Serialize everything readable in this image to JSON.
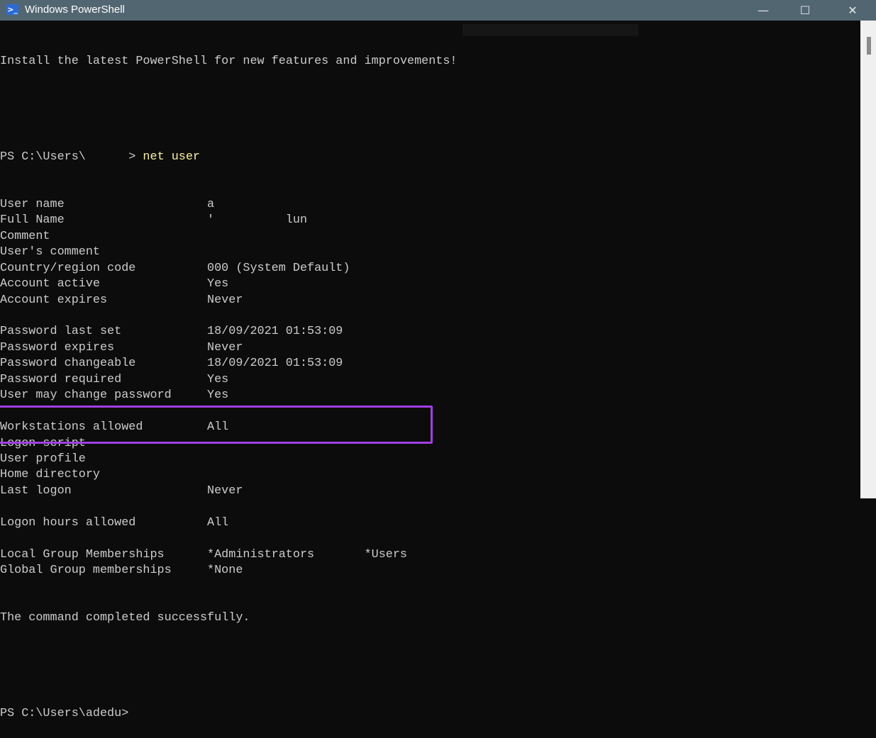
{
  "window": {
    "title": "Windows PowerShell",
    "app_icon": "powershell-icon",
    "controls": {
      "minimize": "—",
      "maximize": "☐",
      "close": "✕"
    }
  },
  "colors": {
    "highlight": "#a23ee6",
    "command": "#f9f1a5",
    "titlebar": "#526672"
  },
  "terminal": {
    "banner": "Install the latest PowerShell for new features and improvements!",
    "prompt1": "PS C:\\Users\\      > ",
    "command": "net user",
    "rows": [
      {
        "label": "User name",
        "value": "a"
      },
      {
        "label": "Full Name",
        "value": "'          lun"
      },
      {
        "label": "Comment",
        "value": ""
      },
      {
        "label": "User's comment",
        "value": ""
      },
      {
        "label": "Country/region code",
        "value": "000 (System Default)"
      },
      {
        "label": "Account active",
        "value": "Yes"
      },
      {
        "label": "Account expires",
        "value": "Never"
      },
      {
        "label": "",
        "value": ""
      },
      {
        "label": "Password last set",
        "value": "18/09/2021 01:53:09"
      },
      {
        "label": "Password expires",
        "value": "Never"
      },
      {
        "label": "Password changeable",
        "value": "18/09/2021 01:53:09"
      },
      {
        "label": "Password required",
        "value": "Yes"
      },
      {
        "label": "User may change password",
        "value": "Yes"
      },
      {
        "label": "",
        "value": ""
      },
      {
        "label": "Workstations allowed",
        "value": "All"
      },
      {
        "label": "Logon script",
        "value": ""
      },
      {
        "label": "User profile",
        "value": ""
      },
      {
        "label": "Home directory",
        "value": ""
      },
      {
        "label": "Last logon",
        "value": "Never"
      },
      {
        "label": "",
        "value": ""
      },
      {
        "label": "Logon hours allowed",
        "value": "All"
      },
      {
        "label": "",
        "value": ""
      },
      {
        "label": "Local Group Memberships",
        "value": "*Administrators       *Users"
      },
      {
        "label": "Global Group memberships",
        "value": "*None"
      }
    ],
    "completion": "The command completed successfully.",
    "prompt2": "PS C:\\Users\\adedu>"
  }
}
